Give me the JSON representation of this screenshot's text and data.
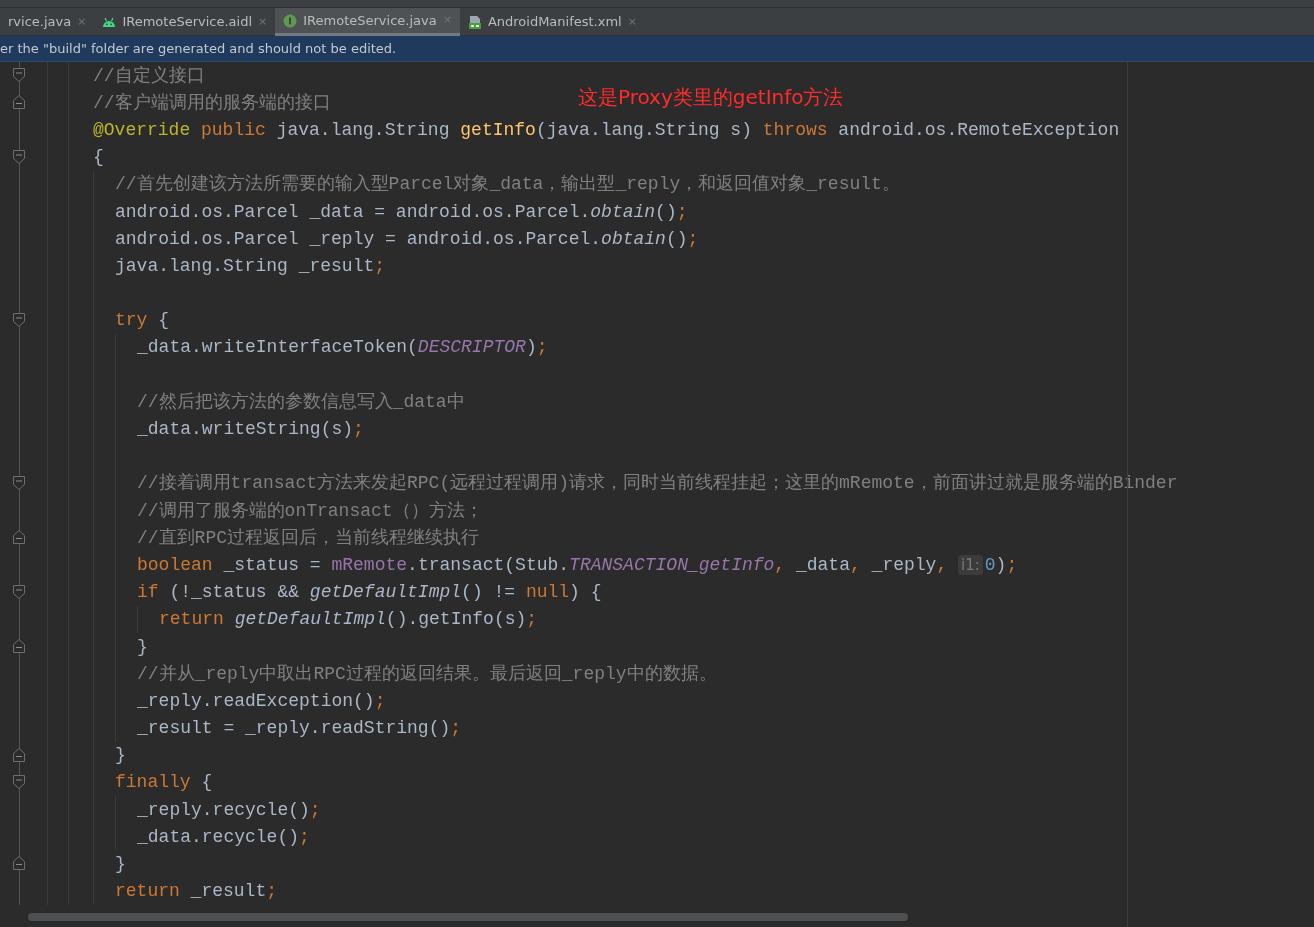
{
  "tabs": [
    {
      "label": "rvice.java",
      "close": "×",
      "selected": false
    },
    {
      "label": "IRemoteService.aidl",
      "kind": "aidl",
      "close": "×",
      "selected": false
    },
    {
      "label": "IRemoteService.java",
      "kind": "java",
      "close": "×",
      "selected": true
    },
    {
      "label": "AndroidManifest.xml",
      "kind": "xml",
      "close": "×",
      "selected": false
    }
  ],
  "banner": {
    "text": "er the \"build\" folder are generated and should not be edited."
  },
  "annotation": {
    "text": "这是Proxy类里的getInfo方法"
  },
  "code": [
    {
      "fold_start": true,
      "tokens": [
        {
          "kind": "comment",
          "text": "//自定义接口"
        }
      ]
    },
    {
      "fold_end": true,
      "tokens": [
        {
          "kind": "comment",
          "text": "//客户端调用的服务端的接口"
        }
      ]
    },
    {
      "tokens": [
        {
          "kind": "annotation",
          "text": "@Override"
        },
        {
          "kind": "keyword",
          "text": " public"
        },
        {
          "kind": "plain",
          "text": " java.lang.String "
        },
        {
          "kind": "method",
          "text": "getInfo"
        },
        {
          "kind": "plain",
          "text": "(java.lang.String s) "
        },
        {
          "kind": "keyword",
          "text": "throws"
        },
        {
          "kind": "plain",
          "text": " android.os.RemoteException"
        }
      ]
    },
    {
      "fold_start": true,
      "tokens": [
        {
          "kind": "plain",
          "text": "{"
        }
      ],
      "children": [
        {
          "tokens": [
            {
              "kind": "comment",
              "text": "//首先创建该方法所需要的输入型Parcel对象_data，输出型_reply，和返回值对象_result。"
            }
          ]
        },
        {
          "tokens": [
            {
              "kind": "plain",
              "text": "android.os.Parcel _data = android.os.Parcel."
            },
            {
              "kind": "italic",
              "text": "obtain"
            },
            {
              "kind": "plain",
              "text": "()"
            },
            {
              "kind": "punct",
              "text": ";"
            }
          ]
        },
        {
          "tokens": [
            {
              "kind": "plain",
              "text": "android.os.Parcel _reply = android.os.Parcel."
            },
            {
              "kind": "italic",
              "text": "obtain"
            },
            {
              "kind": "plain",
              "text": "()"
            },
            {
              "kind": "punct",
              "text": ";"
            }
          ]
        },
        {
          "tokens": [
            {
              "kind": "plain",
              "text": "java.lang.String _result"
            },
            {
              "kind": "punct",
              "text": ";"
            }
          ]
        },
        {
          "kind": "blank"
        },
        {
          "fold_start": true,
          "tokens": [
            {
              "kind": "keyword",
              "text": "try"
            },
            {
              "kind": "plain",
              "text": " {"
            }
          ],
          "children": [
            {
              "tokens": [
                {
                  "kind": "plain",
                  "text": "_data.writeInterfaceToken("
                },
                {
                  "kind": "constant",
                  "text": "DESCRIPTOR"
                },
                {
                  "kind": "plain",
                  "text": ")"
                },
                {
                  "kind": "punct",
                  "text": ";"
                }
              ]
            },
            {
              "kind": "blank"
            },
            {
              "tokens": [
                {
                  "kind": "comment",
                  "text": "//然后把该方法的参数信息写入_data中"
                }
              ]
            },
            {
              "tokens": [
                {
                  "kind": "plain",
                  "text": "_data.writeString(s)"
                },
                {
                  "kind": "punct",
                  "text": ";"
                }
              ]
            },
            {
              "kind": "blank"
            },
            {
              "fold_start": true,
              "tokens": [
                {
                  "kind": "comment",
                  "text": "//接着调用transact方法来发起RPC(远程过程调用)请求，同时当前线程挂起；这里的mRemote，前面讲过就是服务端的Binder"
                }
              ]
            },
            {
              "tokens": [
                {
                  "kind": "comment",
                  "text": "//调用了服务端的onTransact（）方法；"
                }
              ]
            },
            {
              "fold_end": true,
              "tokens": [
                {
                  "kind": "comment",
                  "text": "//直到RPC过程返回后，当前线程继续执行"
                }
              ]
            },
            {
              "tokens": [
                {
                  "kind": "keyword",
                  "text": "boolean"
                },
                {
                  "kind": "plain",
                  "text": " _status = "
                },
                {
                  "kind": "field",
                  "text": "mRemote"
                },
                {
                  "kind": "plain",
                  "text": ".transact(Stub."
                },
                {
                  "kind": "constant",
                  "text": "TRANSACTION_getInfo"
                },
                {
                  "kind": "punct",
                  "text": ","
                },
                {
                  "kind": "plain",
                  "text": " _data"
                },
                {
                  "kind": "punct",
                  "text": ","
                },
                {
                  "kind": "plain",
                  "text": " _reply"
                },
                {
                  "kind": "punct",
                  "text": ", "
                },
                {
                  "kind": "hint",
                  "text": "i1:"
                },
                {
                  "kind": "number",
                  "text": "0"
                },
                {
                  "kind": "plain",
                  "text": ")"
                },
                {
                  "kind": "punct",
                  "text": ";"
                }
              ]
            },
            {
              "fold_start": true,
              "tokens": [
                {
                  "kind": "keyword",
                  "text": "if"
                },
                {
                  "kind": "plain",
                  "text": " (!_status && "
                },
                {
                  "kind": "italic",
                  "text": "getDefaultImpl"
                },
                {
                  "kind": "plain",
                  "text": "() != "
                },
                {
                  "kind": "keyword",
                  "text": "null"
                },
                {
                  "kind": "plain",
                  "text": ") {"
                }
              ],
              "children": [
                {
                  "tokens": [
                    {
                      "kind": "keyword",
                      "text": "return "
                    },
                    {
                      "kind": "italic",
                      "text": "getDefaultImpl"
                    },
                    {
                      "kind": "plain",
                      "text": "().getInfo(s)"
                    },
                    {
                      "kind": "punct",
                      "text": ";"
                    }
                  ]
                }
              ]
            },
            {
              "fold_end": true,
              "tokens": [
                {
                  "kind": "plain",
                  "text": "}"
                }
              ]
            },
            {
              "tokens": [
                {
                  "kind": "comment",
                  "text": "//并从_reply中取出RPC过程的返回结果。最后返回_reply中的数据。"
                }
              ]
            },
            {
              "tokens": [
                {
                  "kind": "plain",
                  "text": "_reply.readException()"
                },
                {
                  "kind": "punct",
                  "text": ";"
                }
              ]
            },
            {
              "tokens": [
                {
                  "kind": "plain",
                  "text": "_result = _reply.readString()"
                },
                {
                  "kind": "punct",
                  "text": ";"
                }
              ]
            }
          ]
        },
        {
          "fold_end": true,
          "tokens": [
            {
              "kind": "plain",
              "text": "}"
            }
          ]
        },
        {
          "fold_start": true,
          "tokens": [
            {
              "kind": "keyword",
              "text": "finally"
            },
            {
              "kind": "plain",
              "text": " {"
            }
          ],
          "children": [
            {
              "tokens": [
                {
                  "kind": "plain",
                  "text": "_reply.recycle()"
                },
                {
                  "kind": "punct",
                  "text": ";"
                }
              ]
            },
            {
              "tokens": [
                {
                  "kind": "plain",
                  "text": "_data.recycle()"
                },
                {
                  "kind": "punct",
                  "text": ";"
                }
              ]
            }
          ]
        },
        {
          "fold_end": true,
          "tokens": [
            {
              "kind": "plain",
              "text": "}"
            }
          ]
        },
        {
          "tokens": [
            {
              "kind": "keyword",
              "text": "return"
            },
            {
              "kind": "plain",
              "text": " _result"
            },
            {
              "kind": "punct",
              "text": ";"
            }
          ]
        }
      ]
    }
  ]
}
